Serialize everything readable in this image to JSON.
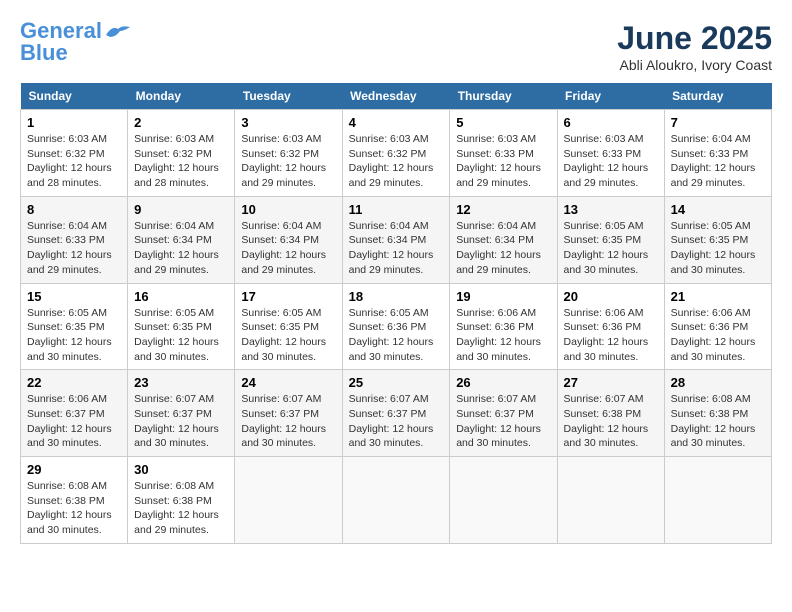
{
  "header": {
    "logo_line1": "General",
    "logo_line2": "Blue",
    "month": "June 2025",
    "location": "Abli Aloukro, Ivory Coast"
  },
  "columns": [
    "Sunday",
    "Monday",
    "Tuesday",
    "Wednesday",
    "Thursday",
    "Friday",
    "Saturday"
  ],
  "weeks": [
    [
      {
        "day": "1",
        "sunrise": "6:03 AM",
        "sunset": "6:32 PM",
        "daylight": "12 hours and 28 minutes."
      },
      {
        "day": "2",
        "sunrise": "6:03 AM",
        "sunset": "6:32 PM",
        "daylight": "12 hours and 28 minutes."
      },
      {
        "day": "3",
        "sunrise": "6:03 AM",
        "sunset": "6:32 PM",
        "daylight": "12 hours and 29 minutes."
      },
      {
        "day": "4",
        "sunrise": "6:03 AM",
        "sunset": "6:32 PM",
        "daylight": "12 hours and 29 minutes."
      },
      {
        "day": "5",
        "sunrise": "6:03 AM",
        "sunset": "6:33 PM",
        "daylight": "12 hours and 29 minutes."
      },
      {
        "day": "6",
        "sunrise": "6:03 AM",
        "sunset": "6:33 PM",
        "daylight": "12 hours and 29 minutes."
      },
      {
        "day": "7",
        "sunrise": "6:04 AM",
        "sunset": "6:33 PM",
        "daylight": "12 hours and 29 minutes."
      }
    ],
    [
      {
        "day": "8",
        "sunrise": "6:04 AM",
        "sunset": "6:33 PM",
        "daylight": "12 hours and 29 minutes."
      },
      {
        "day": "9",
        "sunrise": "6:04 AM",
        "sunset": "6:34 PM",
        "daylight": "12 hours and 29 minutes."
      },
      {
        "day": "10",
        "sunrise": "6:04 AM",
        "sunset": "6:34 PM",
        "daylight": "12 hours and 29 minutes."
      },
      {
        "day": "11",
        "sunrise": "6:04 AM",
        "sunset": "6:34 PM",
        "daylight": "12 hours and 29 minutes."
      },
      {
        "day": "12",
        "sunrise": "6:04 AM",
        "sunset": "6:34 PM",
        "daylight": "12 hours and 29 minutes."
      },
      {
        "day": "13",
        "sunrise": "6:05 AM",
        "sunset": "6:35 PM",
        "daylight": "12 hours and 30 minutes."
      },
      {
        "day": "14",
        "sunrise": "6:05 AM",
        "sunset": "6:35 PM",
        "daylight": "12 hours and 30 minutes."
      }
    ],
    [
      {
        "day": "15",
        "sunrise": "6:05 AM",
        "sunset": "6:35 PM",
        "daylight": "12 hours and 30 minutes."
      },
      {
        "day": "16",
        "sunrise": "6:05 AM",
        "sunset": "6:35 PM",
        "daylight": "12 hours and 30 minutes."
      },
      {
        "day": "17",
        "sunrise": "6:05 AM",
        "sunset": "6:35 PM",
        "daylight": "12 hours and 30 minutes."
      },
      {
        "day": "18",
        "sunrise": "6:05 AM",
        "sunset": "6:36 PM",
        "daylight": "12 hours and 30 minutes."
      },
      {
        "day": "19",
        "sunrise": "6:06 AM",
        "sunset": "6:36 PM",
        "daylight": "12 hours and 30 minutes."
      },
      {
        "day": "20",
        "sunrise": "6:06 AM",
        "sunset": "6:36 PM",
        "daylight": "12 hours and 30 minutes."
      },
      {
        "day": "21",
        "sunrise": "6:06 AM",
        "sunset": "6:36 PM",
        "daylight": "12 hours and 30 minutes."
      }
    ],
    [
      {
        "day": "22",
        "sunrise": "6:06 AM",
        "sunset": "6:37 PM",
        "daylight": "12 hours and 30 minutes."
      },
      {
        "day": "23",
        "sunrise": "6:07 AM",
        "sunset": "6:37 PM",
        "daylight": "12 hours and 30 minutes."
      },
      {
        "day": "24",
        "sunrise": "6:07 AM",
        "sunset": "6:37 PM",
        "daylight": "12 hours and 30 minutes."
      },
      {
        "day": "25",
        "sunrise": "6:07 AM",
        "sunset": "6:37 PM",
        "daylight": "12 hours and 30 minutes."
      },
      {
        "day": "26",
        "sunrise": "6:07 AM",
        "sunset": "6:37 PM",
        "daylight": "12 hours and 30 minutes."
      },
      {
        "day": "27",
        "sunrise": "6:07 AM",
        "sunset": "6:38 PM",
        "daylight": "12 hours and 30 minutes."
      },
      {
        "day": "28",
        "sunrise": "6:08 AM",
        "sunset": "6:38 PM",
        "daylight": "12 hours and 30 minutes."
      }
    ],
    [
      {
        "day": "29",
        "sunrise": "6:08 AM",
        "sunset": "6:38 PM",
        "daylight": "12 hours and 30 minutes."
      },
      {
        "day": "30",
        "sunrise": "6:08 AM",
        "sunset": "6:38 PM",
        "daylight": "12 hours and 29 minutes."
      },
      null,
      null,
      null,
      null,
      null
    ]
  ]
}
